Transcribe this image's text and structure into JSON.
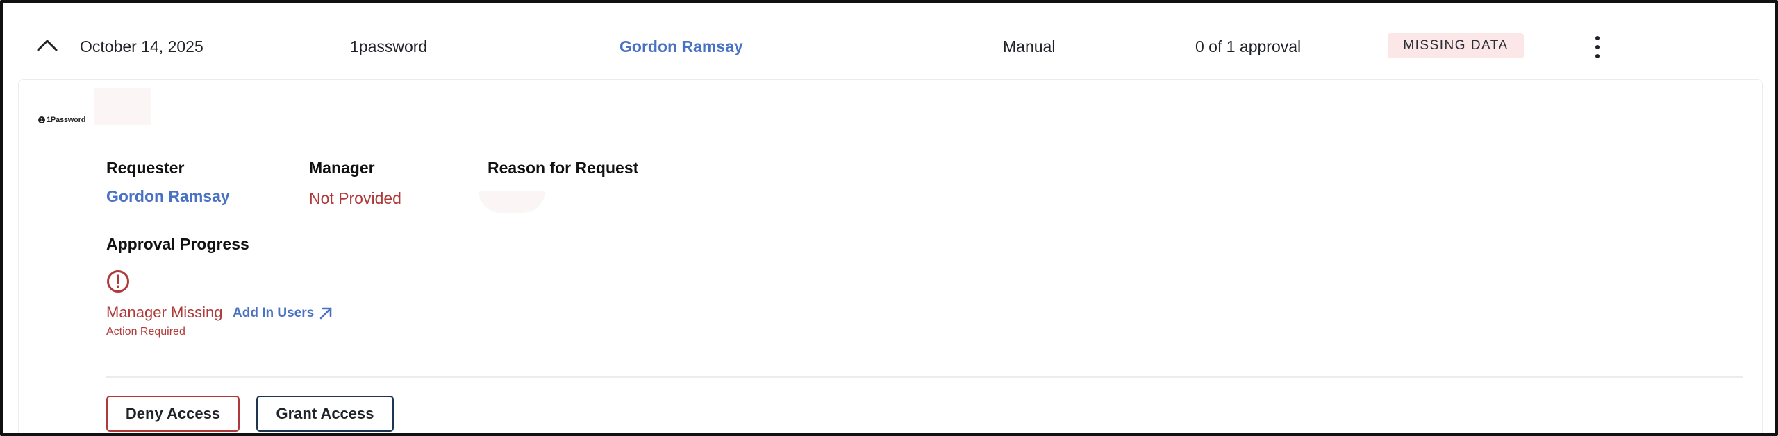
{
  "row": {
    "date": "October 14, 2025",
    "app_name": "1password",
    "requester": "Gordon Ramsay",
    "request_type": "Manual",
    "approvals": "0 of 1 approval",
    "status_badge": "MISSING DATA"
  },
  "details": {
    "app_logo_text": "1Password",
    "requester_label": "Requester",
    "requester_value": "Gordon Ramsay",
    "manager_label": "Manager",
    "manager_value": "Not Provided",
    "reason_label": "Reason for Request",
    "progress_label": "Approval Progress",
    "manager_missing": "Manager Missing",
    "add_in_users": "Add In Users",
    "action_required": "Action Required"
  },
  "actions": {
    "deny": "Deny Access",
    "grant": "Grant Access"
  },
  "colors": {
    "link_blue": "#4a72c4",
    "error_red": "#b03a3a",
    "badge_bg": "#fbe6e8",
    "grant_border": "#1d3550"
  },
  "icons": {
    "collapse": "chevron-up-icon",
    "more": "kebab-menu-icon",
    "alert": "alert-circle-icon",
    "external": "arrow-up-right-icon"
  }
}
